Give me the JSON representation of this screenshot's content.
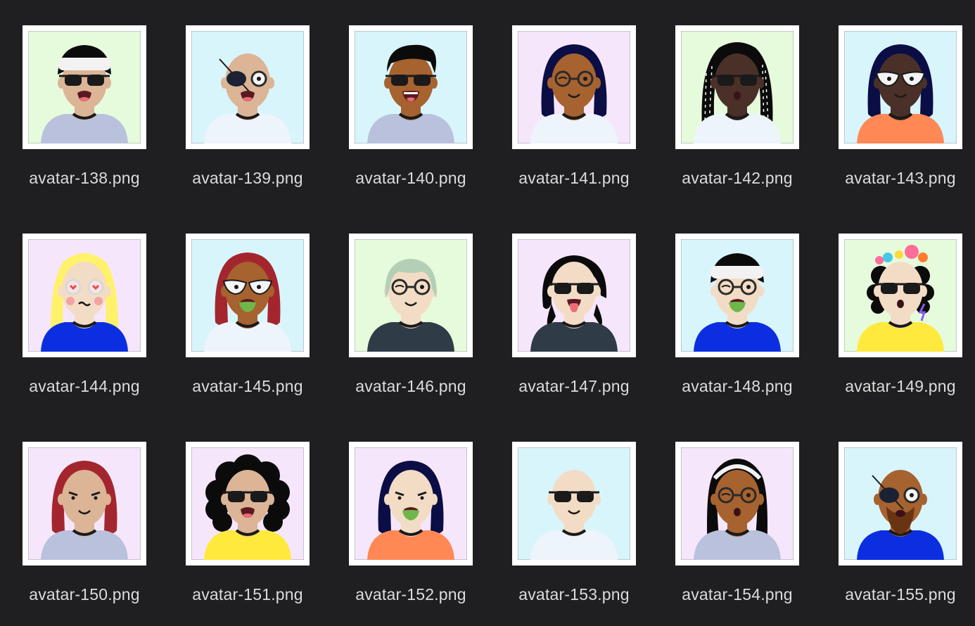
{
  "files": [
    {
      "name": "avatar-138.png",
      "bg": "#e6fbdc",
      "skin": "#dcb496",
      "hair": "#0b0b0b",
      "top": "#b9c1dc",
      "hairstyle": "headband",
      "eyes": "sunglasses",
      "mouth": "open"
    },
    {
      "name": "avatar-139.png",
      "bg": "#d8f5fc",
      "skin": "#dcb496",
      "hair": "none",
      "top": "#eef4fb",
      "hairstyle": "bald",
      "eyes": "eyepatch",
      "mouth": "open"
    },
    {
      "name": "avatar-140.png",
      "bg": "#d8f5fc",
      "skin": "#a6622f",
      "hair": "#0b0b0b",
      "top": "#b9c1dc",
      "hairstyle": "short",
      "eyes": "sunglasses",
      "mouth": "grin"
    },
    {
      "name": "avatar-141.png",
      "bg": "#f6e6fc",
      "skin": "#a6622f",
      "hair": "#0b0e45",
      "top": "#eef4fb",
      "hairstyle": "bob",
      "eyes": "roundglasses",
      "mouth": "smile"
    },
    {
      "name": "avatar-142.png",
      "bg": "#e6fbdc",
      "skin": "#4a3028",
      "hair": "#0b0b0b",
      "top": "#eef4fb",
      "hairstyle": "locs",
      "eyes": "sunglasses",
      "mouth": "small-o"
    },
    {
      "name": "avatar-143.png",
      "bg": "#d8f5fc",
      "skin": "#4a3028",
      "hair": "#0b0e45",
      "top": "#ff8855",
      "hairstyle": "bob",
      "eyes": "catglasses",
      "mouth": "smile"
    },
    {
      "name": "avatar-144.png",
      "bg": "#f6e6fc",
      "skin": "#f3dcc5",
      "hair": "#fff26a",
      "top": "#0b2fe0",
      "hairstyle": "long",
      "eyes": "heartglasses",
      "mouth": "puff"
    },
    {
      "name": "avatar-145.png",
      "bg": "#d8f5fc",
      "skin": "#a6622f",
      "hair": "#a3262e",
      "top": "#eef4fb",
      "hairstyle": "bob",
      "eyes": "catglasses",
      "mouth": "green"
    },
    {
      "name": "avatar-146.png",
      "bg": "#e6fbdc",
      "skin": "#f3dcc5",
      "hair": "#b3d0b6",
      "top": "#2f3b46",
      "hairstyle": "side",
      "eyes": "roundglasses",
      "mouth": "smile"
    },
    {
      "name": "avatar-147.png",
      "bg": "#f6e6fc",
      "skin": "#f3dcc5",
      "hair": "#0b0b0b",
      "top": "#2f3b46",
      "hairstyle": "messy",
      "eyes": "sunglasses",
      "mouth": "tongue"
    },
    {
      "name": "avatar-148.png",
      "bg": "#d8f5fc",
      "skin": "#f3dcc5",
      "hair": "#0b0b0b",
      "top": "#0b2fe0",
      "hairstyle": "headband",
      "eyes": "roundglasses",
      "mouth": "green"
    },
    {
      "name": "avatar-149.png",
      "bg": "#e6fbdc",
      "skin": "#f3dcc5",
      "hair": "#0b0b0b",
      "top": "#ffe93c",
      "hairstyle": "flowers",
      "eyes": "sunglasses",
      "mouth": "small-o"
    },
    {
      "name": "avatar-150.png",
      "bg": "#f6e6fc",
      "skin": "#dcb496",
      "hair": "#a3262e",
      "top": "#b9c1dc",
      "hairstyle": "bob",
      "eyes": "plain",
      "mouth": "smile"
    },
    {
      "name": "avatar-151.png",
      "bg": "#f6e6fc",
      "skin": "#dcb496",
      "hair": "#0b0b0b",
      "top": "#ffe93c",
      "hairstyle": "curly",
      "eyes": "sunglasses",
      "mouth": "open"
    },
    {
      "name": "avatar-152.png",
      "bg": "#f6e6fc",
      "skin": "#f3dcc5",
      "hair": "#0b0e45",
      "top": "#ff8855",
      "hairstyle": "bob",
      "eyes": "plain",
      "mouth": "green"
    },
    {
      "name": "avatar-153.png",
      "bg": "#d8f5fc",
      "skin": "#f3dcc5",
      "hair": "none",
      "top": "#eef4fb",
      "hairstyle": "bald",
      "eyes": "sunglasses",
      "mouth": "smile"
    },
    {
      "name": "avatar-154.png",
      "bg": "#f6e6fc",
      "skin": "#a6622f",
      "hair": "#0b0b0b",
      "top": "#b9c1dc",
      "hairstyle": "headband-long",
      "eyes": "roundglasses",
      "mouth": "small-o"
    },
    {
      "name": "avatar-155.png",
      "bg": "#d8f5fc",
      "skin": "#a6622f",
      "hair": "none",
      "top": "#0b2fe0",
      "hairstyle": "bald",
      "eyes": "eyepatch",
      "mouth": "beard"
    }
  ]
}
